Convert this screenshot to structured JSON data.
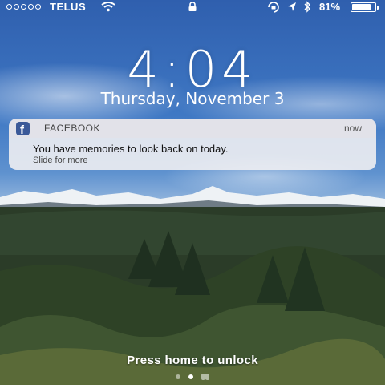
{
  "status_bar": {
    "carrier": "TELUS",
    "signal_bars_filled": 0,
    "battery_percent": "81%",
    "battery_level": 0.81,
    "icons": [
      "wifi-icon",
      "lock-icon",
      "rotation-lock-icon",
      "location-icon",
      "bluetooth-icon",
      "battery-icon"
    ]
  },
  "lock_screen": {
    "time": "4:04",
    "date": "Thursday, November 3",
    "unlock_hint": "Press home to unlock"
  },
  "notification": {
    "app_name": "FACEBOOK",
    "app_icon": "facebook-icon",
    "time": "now",
    "message": "You have memories to look back on today.",
    "action_hint": "Slide for more",
    "accent_color": "#3b5998"
  },
  "pager": {
    "pages": 2,
    "active_index": 0,
    "extra_icon": "camera-icon"
  }
}
